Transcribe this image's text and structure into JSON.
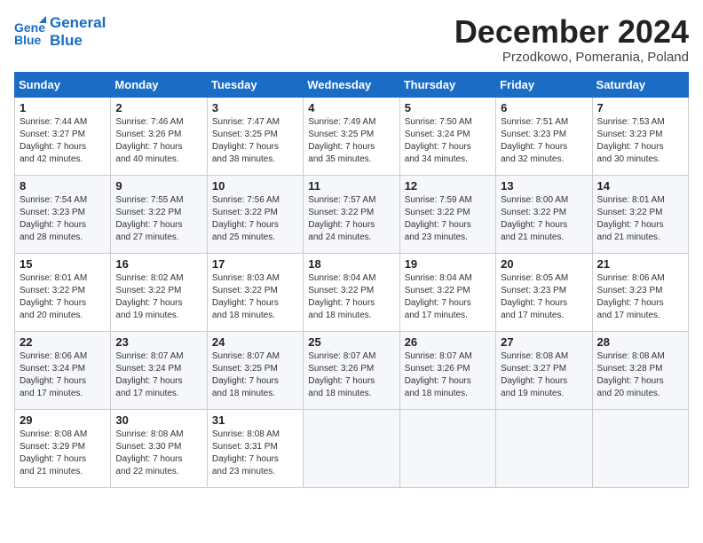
{
  "header": {
    "logo_line1": "General",
    "logo_line2": "Blue",
    "month_title": "December 2024",
    "subtitle": "Przodkowo, Pomerania, Poland"
  },
  "weekdays": [
    "Sunday",
    "Monday",
    "Tuesday",
    "Wednesday",
    "Thursday",
    "Friday",
    "Saturday"
  ],
  "weeks": [
    [
      {
        "day": "1",
        "info": "Sunrise: 7:44 AM\nSunset: 3:27 PM\nDaylight: 7 hours\nand 42 minutes."
      },
      {
        "day": "2",
        "info": "Sunrise: 7:46 AM\nSunset: 3:26 PM\nDaylight: 7 hours\nand 40 minutes."
      },
      {
        "day": "3",
        "info": "Sunrise: 7:47 AM\nSunset: 3:25 PM\nDaylight: 7 hours\nand 38 minutes."
      },
      {
        "day": "4",
        "info": "Sunrise: 7:49 AM\nSunset: 3:25 PM\nDaylight: 7 hours\nand 35 minutes."
      },
      {
        "day": "5",
        "info": "Sunrise: 7:50 AM\nSunset: 3:24 PM\nDaylight: 7 hours\nand 34 minutes."
      },
      {
        "day": "6",
        "info": "Sunrise: 7:51 AM\nSunset: 3:23 PM\nDaylight: 7 hours\nand 32 minutes."
      },
      {
        "day": "7",
        "info": "Sunrise: 7:53 AM\nSunset: 3:23 PM\nDaylight: 7 hours\nand 30 minutes."
      }
    ],
    [
      {
        "day": "8",
        "info": "Sunrise: 7:54 AM\nSunset: 3:23 PM\nDaylight: 7 hours\nand 28 minutes."
      },
      {
        "day": "9",
        "info": "Sunrise: 7:55 AM\nSunset: 3:22 PM\nDaylight: 7 hours\nand 27 minutes."
      },
      {
        "day": "10",
        "info": "Sunrise: 7:56 AM\nSunset: 3:22 PM\nDaylight: 7 hours\nand 25 minutes."
      },
      {
        "day": "11",
        "info": "Sunrise: 7:57 AM\nSunset: 3:22 PM\nDaylight: 7 hours\nand 24 minutes."
      },
      {
        "day": "12",
        "info": "Sunrise: 7:59 AM\nSunset: 3:22 PM\nDaylight: 7 hours\nand 23 minutes."
      },
      {
        "day": "13",
        "info": "Sunrise: 8:00 AM\nSunset: 3:22 PM\nDaylight: 7 hours\nand 21 minutes."
      },
      {
        "day": "14",
        "info": "Sunrise: 8:01 AM\nSunset: 3:22 PM\nDaylight: 7 hours\nand 21 minutes."
      }
    ],
    [
      {
        "day": "15",
        "info": "Sunrise: 8:01 AM\nSunset: 3:22 PM\nDaylight: 7 hours\nand 20 minutes."
      },
      {
        "day": "16",
        "info": "Sunrise: 8:02 AM\nSunset: 3:22 PM\nDaylight: 7 hours\nand 19 minutes."
      },
      {
        "day": "17",
        "info": "Sunrise: 8:03 AM\nSunset: 3:22 PM\nDaylight: 7 hours\nand 18 minutes."
      },
      {
        "day": "18",
        "info": "Sunrise: 8:04 AM\nSunset: 3:22 PM\nDaylight: 7 hours\nand 18 minutes."
      },
      {
        "day": "19",
        "info": "Sunrise: 8:04 AM\nSunset: 3:22 PM\nDaylight: 7 hours\nand 17 minutes."
      },
      {
        "day": "20",
        "info": "Sunrise: 8:05 AM\nSunset: 3:23 PM\nDaylight: 7 hours\nand 17 minutes."
      },
      {
        "day": "21",
        "info": "Sunrise: 8:06 AM\nSunset: 3:23 PM\nDaylight: 7 hours\nand 17 minutes."
      }
    ],
    [
      {
        "day": "22",
        "info": "Sunrise: 8:06 AM\nSunset: 3:24 PM\nDaylight: 7 hours\nand 17 minutes."
      },
      {
        "day": "23",
        "info": "Sunrise: 8:07 AM\nSunset: 3:24 PM\nDaylight: 7 hours\nand 17 minutes."
      },
      {
        "day": "24",
        "info": "Sunrise: 8:07 AM\nSunset: 3:25 PM\nDaylight: 7 hours\nand 18 minutes."
      },
      {
        "day": "25",
        "info": "Sunrise: 8:07 AM\nSunset: 3:26 PM\nDaylight: 7 hours\nand 18 minutes."
      },
      {
        "day": "26",
        "info": "Sunrise: 8:07 AM\nSunset: 3:26 PM\nDaylight: 7 hours\nand 18 minutes."
      },
      {
        "day": "27",
        "info": "Sunrise: 8:08 AM\nSunset: 3:27 PM\nDaylight: 7 hours\nand 19 minutes."
      },
      {
        "day": "28",
        "info": "Sunrise: 8:08 AM\nSunset: 3:28 PM\nDaylight: 7 hours\nand 20 minutes."
      }
    ],
    [
      {
        "day": "29",
        "info": "Sunrise: 8:08 AM\nSunset: 3:29 PM\nDaylight: 7 hours\nand 21 minutes."
      },
      {
        "day": "30",
        "info": "Sunrise: 8:08 AM\nSunset: 3:30 PM\nDaylight: 7 hours\nand 22 minutes."
      },
      {
        "day": "31",
        "info": "Sunrise: 8:08 AM\nSunset: 3:31 PM\nDaylight: 7 hours\nand 23 minutes."
      },
      null,
      null,
      null,
      null
    ]
  ]
}
